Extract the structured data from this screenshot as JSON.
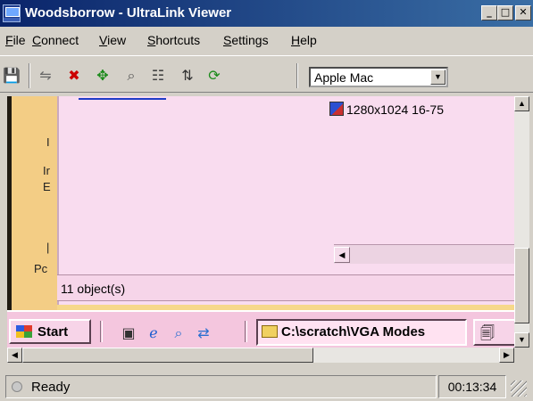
{
  "window": {
    "title": "Woodsborrow - UltraLink Viewer",
    "min": "_",
    "max": "□",
    "close": "✕"
  },
  "menu": [
    {
      "ul": "F",
      "rest": "ile"
    },
    {
      "ul": "C",
      "rest": "onnect"
    },
    {
      "ul": "V",
      "rest": "iew"
    },
    {
      "ul": "S",
      "rest": "hortcuts"
    },
    {
      "ul": "S",
      "rest": "ettings"
    },
    {
      "ul": "H",
      "rest": "elp"
    }
  ],
  "toolbar": {
    "icons": [
      "save-icon",
      "disconnect-icon",
      "no-connect-icon",
      "fit-screen-icon",
      "zoom-icon",
      "settings-sliders-icon",
      "sort-icon",
      "refresh-icon"
    ],
    "platform_value": "Apple Mac",
    "arrow": "▼"
  },
  "remote": {
    "fragments": [
      "I",
      "Ir",
      "E",
      "|",
      "Pc"
    ],
    "mode_item": "1280x1024 16-75",
    "status_text": "11 object(s)",
    "start_label": "Start",
    "task_label": "C:\\scratch\\VGA Modes",
    "hs_left": "◀"
  },
  "scroll": {
    "up": "▲",
    "down": "▼",
    "left": "◀",
    "right": "▶"
  },
  "status": {
    "text": "Ready",
    "time": "00:13:34"
  }
}
